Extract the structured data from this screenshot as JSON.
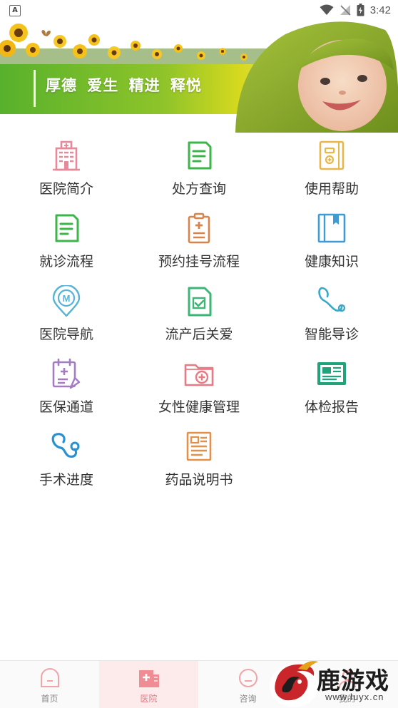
{
  "status_bar": {
    "time": "3:42",
    "indicator": "A"
  },
  "banner": {
    "slogan": "厚德 爱生 精进 释悦"
  },
  "menu": [
    {
      "label": "医院简介",
      "icon": "hospital-building-icon",
      "color": "#e8899a"
    },
    {
      "label": "处方查询",
      "icon": "prescription-document-icon",
      "color": "#3cb54a"
    },
    {
      "label": "使用帮助",
      "icon": "help-book-icon",
      "color": "#e9b64a"
    },
    {
      "label": "就诊流程",
      "icon": "visit-process-document-icon",
      "color": "#3cb54a"
    },
    {
      "label": "预约挂号流程",
      "icon": "appointment-clipboard-icon",
      "color": "#d9824a"
    },
    {
      "label": "健康知识",
      "icon": "health-knowledge-book-icon",
      "color": "#3f9bd3"
    },
    {
      "label": "医院导航",
      "icon": "map-pin-navigation-icon",
      "color": "#56b3d6"
    },
    {
      "label": "流产后关爱",
      "icon": "care-document-check-icon",
      "color": "#3cb576"
    },
    {
      "label": "智能导诊",
      "icon": "stethoscope-icon",
      "color": "#39a9c9"
    },
    {
      "label": "医保通道",
      "icon": "insurance-calendar-icon",
      "color": "#a47cc2"
    },
    {
      "label": "女性健康管理",
      "icon": "medical-folder-icon",
      "color": "#e77a82"
    },
    {
      "label": "体检报告",
      "icon": "report-newspaper-icon",
      "color": "#1ea37a"
    },
    {
      "label": "手术进度",
      "icon": "surgery-stethoscope-icon",
      "color": "#2a91d0"
    },
    {
      "label": "药品说明书",
      "icon": "drug-instructions-icon",
      "color": "#e3914a"
    }
  ],
  "tabs": [
    {
      "label": "首页",
      "icon": "home-icon",
      "active": false
    },
    {
      "label": "医院",
      "icon": "hospital-icon",
      "active": true
    },
    {
      "label": "咨询",
      "icon": "consult-icon",
      "active": false
    },
    {
      "label": "我的",
      "icon": "profile-icon",
      "active": false
    }
  ],
  "watermark": {
    "text": "鹿游戏",
    "url": "www.luyx.cn"
  }
}
